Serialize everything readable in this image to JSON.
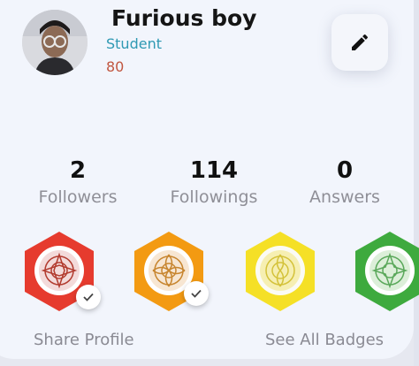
{
  "profile": {
    "name": "Furious boy",
    "role": "Student",
    "points": "80"
  },
  "stats": [
    {
      "value": "2",
      "label": "Followers"
    },
    {
      "value": "114",
      "label": "Followings"
    },
    {
      "value": "0",
      "label": "Answers"
    }
  ],
  "badges": [
    {
      "color": "#e63b2e",
      "earned": true
    },
    {
      "color": "#f39a12",
      "earned": true
    },
    {
      "color": "#f5e026",
      "earned": false
    },
    {
      "color": "#3eaa3e",
      "earned": false
    }
  ],
  "links": {
    "share_profile": "Share Profile",
    "see_all_badges": "See All Badges"
  },
  "icons": {
    "edit": "pencil-icon",
    "check": "check-icon"
  }
}
